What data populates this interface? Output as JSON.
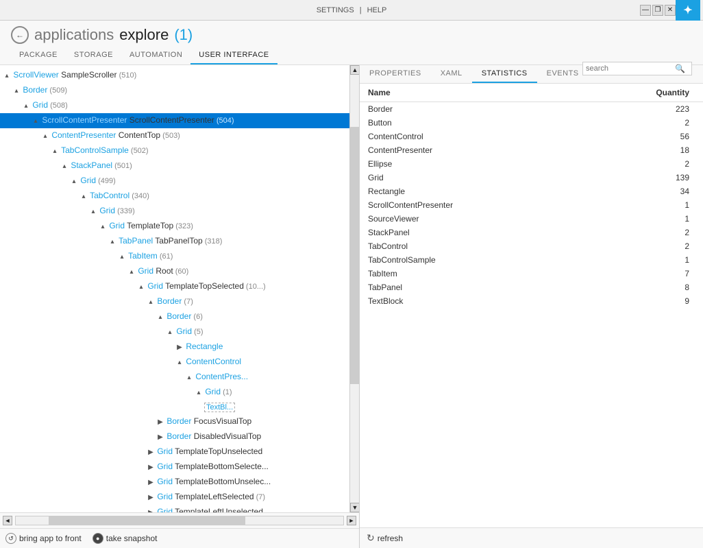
{
  "titlebar": {
    "settings_label": "SETTINGS",
    "help_label": "HELP",
    "separator": "|",
    "win_minimize": "—",
    "win_restore": "❐",
    "win_close": "✕"
  },
  "app": {
    "back_arrow": "←",
    "name": "applications",
    "section": "explore",
    "count": "(1)"
  },
  "nav": {
    "tabs": [
      "PACKAGE",
      "STORAGE",
      "AUTOMATION",
      "USER INTERFACE"
    ],
    "active_tab": "USER INTERFACE"
  },
  "search": {
    "placeholder": "search"
  },
  "left_panel": {
    "tree_nodes": [
      {
        "indent": 0,
        "expander": "▴",
        "type": "ScrollViewer",
        "name": "SampleScroller",
        "count": "(510)"
      },
      {
        "indent": 1,
        "expander": "▴",
        "type": "Border",
        "name": "",
        "count": "(509)"
      },
      {
        "indent": 2,
        "expander": "▴",
        "type": "Grid",
        "name": "",
        "count": "(508)"
      },
      {
        "indent": 3,
        "expander": "▴",
        "type": "ScrollContentPresenter",
        "name": "ScrollContentPresenter",
        "count": "(504)",
        "selected": true
      },
      {
        "indent": 4,
        "expander": "▴",
        "type": "ContentPresenter",
        "name": "ContentTop",
        "count": "(503)"
      },
      {
        "indent": 5,
        "expander": "▴",
        "type": "TabControlSample",
        "name": "",
        "count": "(502)"
      },
      {
        "indent": 6,
        "expander": "▴",
        "type": "StackPanel",
        "name": "",
        "count": "(501)"
      },
      {
        "indent": 7,
        "expander": "▴",
        "type": "Grid",
        "name": "",
        "count": "(499)"
      },
      {
        "indent": 8,
        "expander": "▴",
        "type": "TabControl",
        "name": "",
        "count": "(340)"
      },
      {
        "indent": 9,
        "expander": "▴",
        "type": "Grid",
        "name": "",
        "count": "(339)"
      },
      {
        "indent": 10,
        "expander": "▴",
        "type": "Grid",
        "name": "TemplateTop",
        "count": "(323)"
      },
      {
        "indent": 11,
        "expander": "▴",
        "type": "TabPanel",
        "name": "TabPanelTop",
        "count": "(318)"
      },
      {
        "indent": 12,
        "expander": "▴",
        "type": "TabItem",
        "name": "",
        "count": "(61)"
      },
      {
        "indent": 13,
        "expander": "▴",
        "type": "Grid",
        "name": "Root",
        "count": "(60)"
      },
      {
        "indent": 14,
        "expander": "▴",
        "type": "Grid",
        "name": "TemplateTopSelected",
        "count": "(10...)"
      },
      {
        "indent": 15,
        "expander": "▴",
        "type": "Border",
        "name": "",
        "count": "(7)"
      },
      {
        "indent": 16,
        "expander": "▴",
        "type": "Border",
        "name": "",
        "count": "(6)"
      },
      {
        "indent": 17,
        "expander": "▴",
        "type": "Grid",
        "name": "",
        "count": "(5)"
      },
      {
        "indent": 18,
        "expander": "▶",
        "type": "Rectangle",
        "name": "",
        "count": ""
      },
      {
        "indent": 18,
        "expander": "▴",
        "type": "ContentControl",
        "name": "",
        "count": ""
      },
      {
        "indent": 19,
        "expander": "▴",
        "type": "ContentPres...",
        "name": "",
        "count": ""
      },
      {
        "indent": 20,
        "expander": "▴",
        "type": "Grid",
        "name": "",
        "count": "(1)"
      },
      {
        "indent": 21,
        "expander": "",
        "type": "TextBl...",
        "name": "",
        "count": "",
        "dashed": true
      },
      {
        "indent": 16,
        "expander": "▶",
        "type": "Border",
        "name": "FocusVisualTop",
        "count": ""
      },
      {
        "indent": 16,
        "expander": "▶",
        "type": "Border",
        "name": "DisabledVisualTop",
        "count": ""
      },
      {
        "indent": 15,
        "expander": "▶",
        "type": "Grid",
        "name": "TemplateTopUnselected",
        "count": ""
      },
      {
        "indent": 15,
        "expander": "▶",
        "type": "Grid",
        "name": "TemplateBottomSelecte...",
        "count": ""
      },
      {
        "indent": 15,
        "expander": "▶",
        "type": "Grid",
        "name": "TemplateBottomUnselec...",
        "count": ""
      },
      {
        "indent": 15,
        "expander": "▶",
        "type": "Grid",
        "name": "TemplateLeftSelected",
        "count": "(7)"
      },
      {
        "indent": 15,
        "expander": "▶",
        "type": "Grid",
        "name": "TemplateLeftUnselected",
        "count": ""
      }
    ],
    "actions": [
      {
        "icon": "↺",
        "label": "bring app to front"
      },
      {
        "icon": "●",
        "label": "take snapshot"
      }
    ]
  },
  "right_panel": {
    "tabs": [
      "PROPERTIES",
      "XAML",
      "STATISTICS",
      "EVENTS"
    ],
    "active_tab": "STATISTICS",
    "table": {
      "headers": [
        "Name",
        "Quantity"
      ],
      "rows": [
        {
          "name": "Border",
          "qty": 223
        },
        {
          "name": "Button",
          "qty": 2
        },
        {
          "name": "ContentControl",
          "qty": 56
        },
        {
          "name": "ContentPresenter",
          "qty": 18
        },
        {
          "name": "Ellipse",
          "qty": 2
        },
        {
          "name": "Grid",
          "qty": 139
        },
        {
          "name": "Rectangle",
          "qty": 34
        },
        {
          "name": "ScrollContentPresenter",
          "qty": 1
        },
        {
          "name": "SourceViewer",
          "qty": 1
        },
        {
          "name": "StackPanel",
          "qty": 2
        },
        {
          "name": "TabControl",
          "qty": 2
        },
        {
          "name": "TabControlSample",
          "qty": 1
        },
        {
          "name": "TabItem",
          "qty": 7
        },
        {
          "name": "TabPanel",
          "qty": 8
        },
        {
          "name": "TextBlock",
          "qty": 9
        }
      ]
    },
    "refresh_label": "refresh"
  }
}
